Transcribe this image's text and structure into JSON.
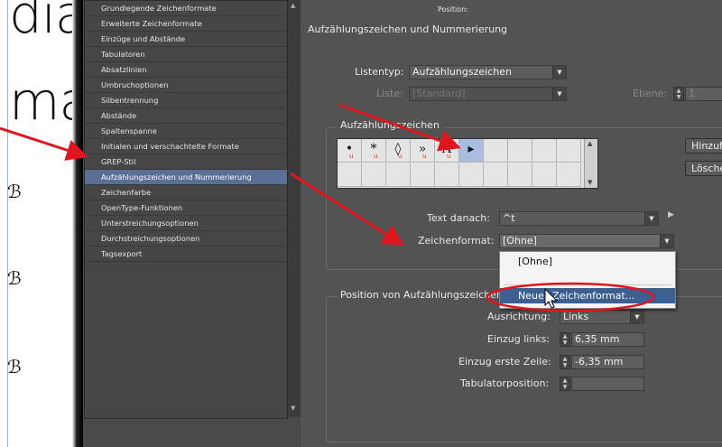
{
  "categories": [
    "Grundlegende Zeichenformate",
    "Erweiterte Zeichenformate",
    "Einzüge und Abstände",
    "Tabulatoren",
    "Absatzlinien",
    "Umbruchoptionen",
    "Silbentrennung",
    "Abstände",
    "Spaltenspanne",
    "Initialen und verschachtelte Formate",
    "GREP-Stil",
    "Aufzählungszeichen und Nummerierung",
    "Zeichenfarbe",
    "OpenType-Funktionen",
    "Unterstreichungsoptionen",
    "Durchstreichungsoptionen",
    "Tagsexport"
  ],
  "selected_category_index": 11,
  "document": {
    "text_line1": "dia",
    "text_line2": "ma"
  },
  "panel": {
    "top_label": "Position:",
    "section_title": "Aufzählungszeichen und Nummerierung",
    "listentyp_label": "Listentyp:",
    "listentyp_value": "Aufzählungszeichen",
    "liste_label": "Liste:",
    "liste_value": "[Standard]",
    "ebene_label": "Ebene:",
    "ebene_value": "1"
  },
  "bullets_group": {
    "title": "Aufzählungszeichen",
    "glyphs": [
      "•",
      "*",
      "◊",
      "»",
      "A",
      "▸",
      "",
      "",
      "",
      "",
      "",
      "",
      "",
      "",
      "",
      "",
      "",
      "",
      "",
      ""
    ],
    "unicode_marker": "u",
    "selected_index": 5,
    "add_button": "Hinzufügen...",
    "delete_button": "Löschen"
  },
  "text_danach": {
    "label": "Text danach:",
    "value": "^t"
  },
  "zeichenformat": {
    "label": "Zeichenformat:",
    "value": "[Ohne]"
  },
  "popup": {
    "options": [
      "[Ohne]",
      "Neues Zeichenformat..."
    ],
    "highlighted_index": 1
  },
  "position_group": {
    "title": "Position von Aufzählungszeichen",
    "ausrichtung_label": "Ausrichtung:",
    "ausrichtung_value": "Links",
    "einzug_links_label": "Einzug links:",
    "einzug_links_value": "6,35 mm",
    "einzug_erste_label": "Einzug erste Zeile:",
    "einzug_erste_value": "-6,35 mm",
    "tabulator_label": "Tabulatorposition:",
    "tabulator_value": ""
  },
  "colors": {
    "arrow": "#e0161f",
    "selection": "#5a6e96",
    "highlight": "#3d5f92"
  }
}
